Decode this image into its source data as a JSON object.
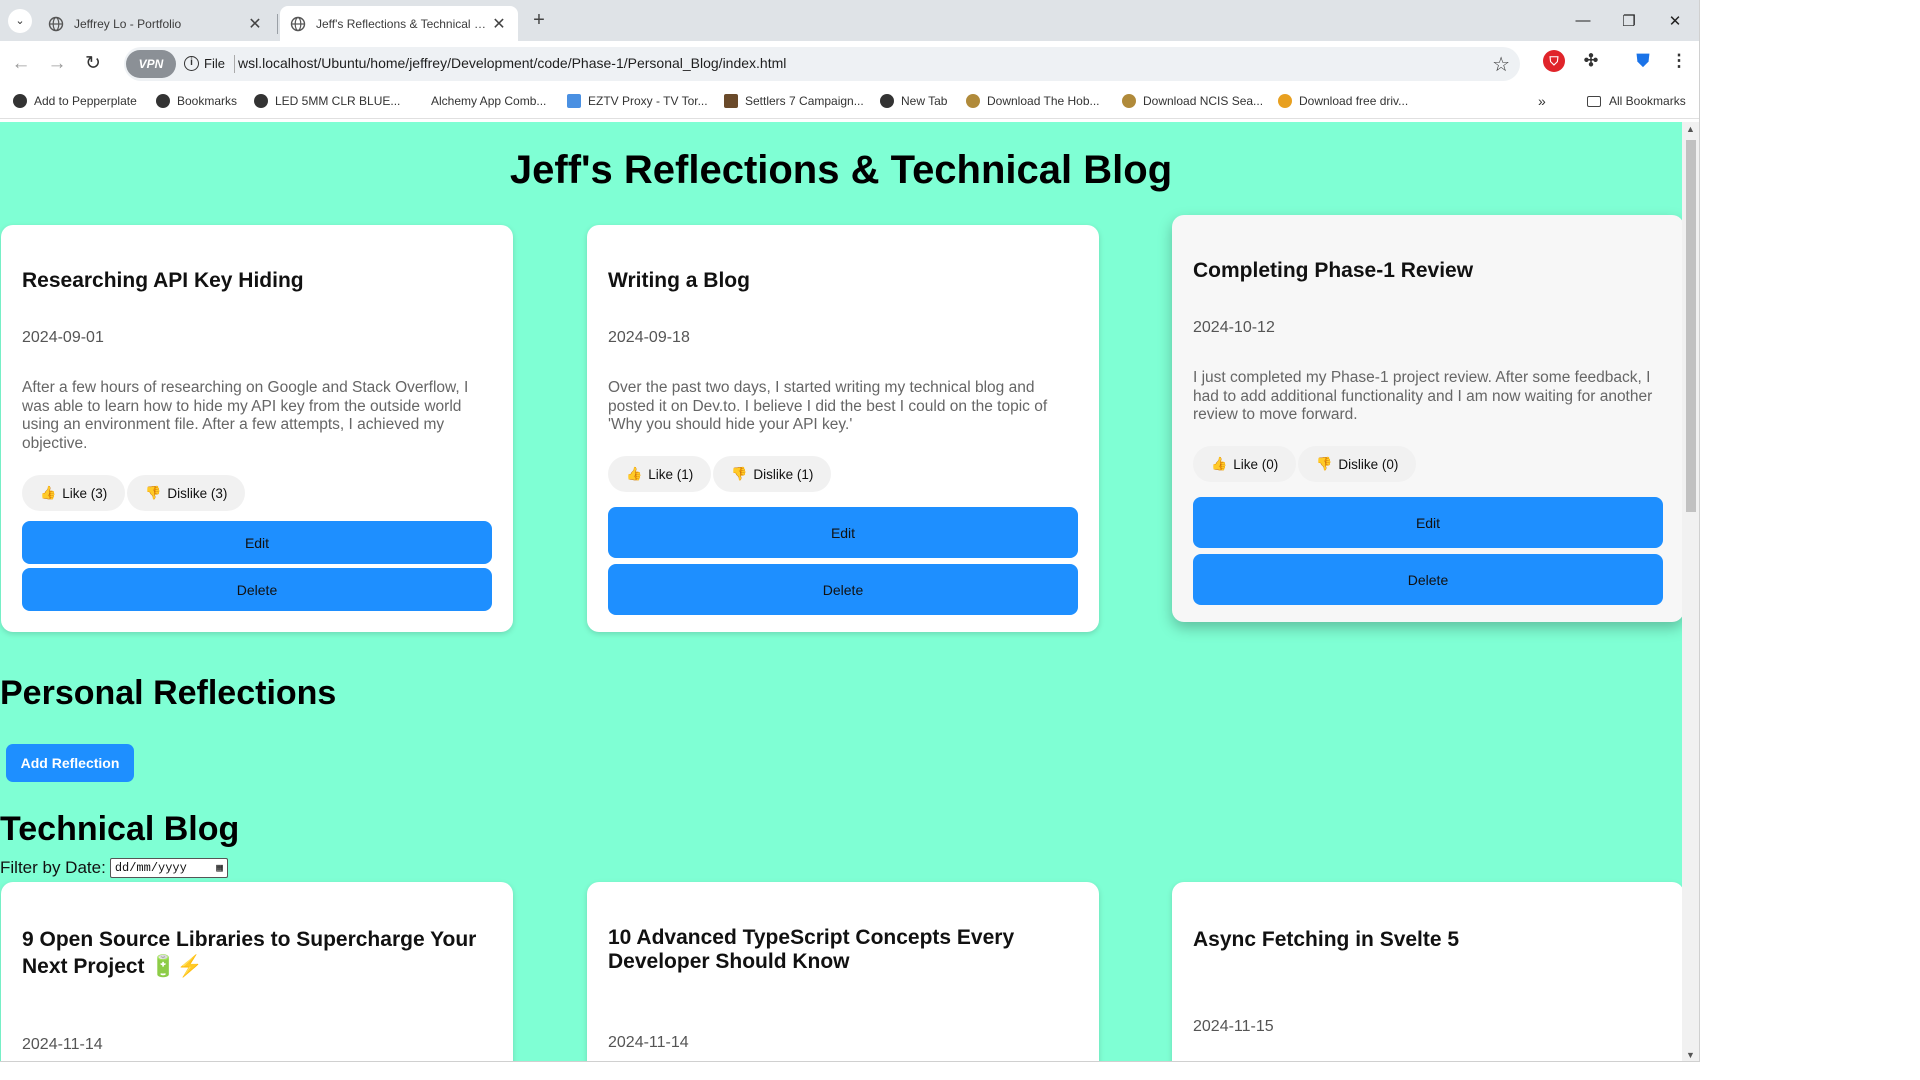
{
  "browser": {
    "tabs": [
      {
        "title": "Jeffrey Lo - Portfolio",
        "active": false
      },
      {
        "title": "Jeff's Reflections & Technical Blog",
        "active": true
      }
    ],
    "vpn_label": "VPN",
    "scheme": "File",
    "url": "wsl.localhost/Ubuntu/home/jeffrey/Development/code/Phase-1/Personal_Blog/index.html",
    "bookmarks": [
      {
        "label": "Add to Pepperplate",
        "icon_color": "#333333"
      },
      {
        "label": "Bookmarks",
        "icon_color": "#333333"
      },
      {
        "label": "LED 5MM CLR BLUE...",
        "icon_color": "#333333"
      },
      {
        "label": "Alchemy App Comb...",
        "icon_color": "#ffffff"
      },
      {
        "label": "EZTV Proxy - TV Tor...",
        "icon_color": "#4a90e2"
      },
      {
        "label": "Settlers 7 Campaign...",
        "icon_color": "#6a4a2a"
      },
      {
        "label": "New Tab",
        "icon_color": "#333333"
      },
      {
        "label": "Download The Hob...",
        "icon_color": "#b08a3a"
      },
      {
        "label": "Download NCIS Sea...",
        "icon_color": "#b08a3a"
      },
      {
        "label": "Download free driv...",
        "icon_color": "#e8a020"
      }
    ],
    "all_bookmarks": "All Bookmarks",
    "more_bookmarks": "»"
  },
  "page": {
    "title": "Jeff's Reflections & Technical Blog",
    "reflections": [
      {
        "title": "Researching API Key Hiding",
        "date": "2024-09-01",
        "body": "After a few hours of researching on Google and Stack Overflow, I was able to learn how to hide my API key from the outside world using an environment file. After a few attempts, I achieved my objective.",
        "like": "Like (3)",
        "dislike": "Dislike (3)",
        "edit": "Edit",
        "delete": "Delete"
      },
      {
        "title": "Writing a Blog",
        "date": "2024-09-18",
        "body": "Over the past two days, I started writing my technical blog and posted it on Dev.to. I believe I did the best I could on the topic of 'Why you should hide your API key.'",
        "like": "Like (1)",
        "dislike": "Dislike (1)",
        "edit": "Edit",
        "delete": "Delete"
      },
      {
        "title": "Completing Phase-1 Review",
        "date": "2024-10-12",
        "body": "I just completed my Phase-1 project review. After some feedback, I had to add additional functionality and I am now waiting for another review to move forward.",
        "like": "Like (0)",
        "dislike": "Dislike (0)",
        "edit": "Edit",
        "delete": "Delete"
      }
    ],
    "personal_heading": "Personal Reflections",
    "add_reflection": "Add Reflection",
    "technical_heading": "Technical Blog",
    "filter_label": "Filter by Date:",
    "filter_placeholder": "dd/mm/yyyy",
    "articles": [
      {
        "title": "9 Open Source Libraries to Supercharge Your Next Project 🔋⚡",
        "date": "2024-11-14"
      },
      {
        "title": "10 Advanced TypeScript Concepts Every Developer Should Know",
        "date": "2024-11-14"
      },
      {
        "title": "Async Fetching in Svelte 5",
        "date": "2024-11-15"
      }
    ]
  },
  "colors": {
    "page_bg": "#7fffd4",
    "button_blue": "#1e8fff",
    "card_bg": "#ffffff"
  }
}
